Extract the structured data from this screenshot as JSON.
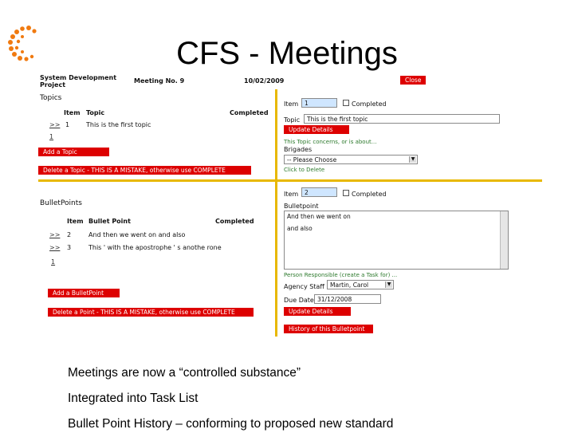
{
  "slide": {
    "title": "CFS - Meetings",
    "bullets": [
      "Meetings are now a “controlled substance”",
      "Integrated into Task List",
      "Bullet Point History – conforming to proposed new standard"
    ]
  },
  "screen": {
    "project_line1": "System Development",
    "project_line2": "Project",
    "meeting_no": "Meeting No. 9",
    "date": "10/02/2009",
    "close_label": "Close",
    "topics": {
      "heading": "Topics",
      "col_item": "Item",
      "col_topic": "Topic",
      "col_completed": "Completed",
      "rows": [
        {
          "marker": ">>",
          "item": "1",
          "text": "This is the first topic"
        }
      ],
      "new_item": "1",
      "add_label": "Add a Topic",
      "delete_label": "Delete a Topic - THIS IS A MISTAKE, otherwise use COMPLETE"
    },
    "topic_detail": {
      "item_label": "Item",
      "item_value": "1",
      "completed_label": "Completed",
      "topic_label": "Topic",
      "topic_value": "This is the first topic",
      "update_label": "Update Details",
      "concerns_text": "This Topic concerns, or is about...",
      "brigades_label": "Brigades",
      "brigades_value": "-- Please Choose",
      "click_delete": "Click to Delete"
    },
    "bullets": {
      "heading": "BulletPoints",
      "col_item": "Item",
      "col_bullet": "Bullet Point",
      "col_completed": "Completed",
      "rows": [
        {
          "marker": ">>",
          "item": "2",
          "text": "And then we went on and also"
        },
        {
          "marker": ">>",
          "item": "3",
          "text": "This ' with the apostrophe ' s anothe rone"
        }
      ],
      "new_item": "1",
      "add_label": "Add a BulletPoint",
      "delete_label": "Delete a Point - THIS IS A MISTAKE, otherwise use COMPLETE"
    },
    "bullet_detail": {
      "item_label": "Item",
      "item_value": "2",
      "completed_label": "Completed",
      "bulletpoint_label": "Bulletpoint",
      "bulletpoint_line1": "And then we went on",
      "bulletpoint_line2": "and also",
      "person_text": "Person Responsible (create a Task for) ...",
      "agency_label": "Agency Staff",
      "agency_value": "Martin, Carol",
      "due_label": "Due Date",
      "due_value": "31/12/2008",
      "update_label": "Update Details",
      "history_label": "History of this Bulletpoint"
    },
    "colors": {
      "accent_red": "#dd0000",
      "divider_yellow": "#e8b800",
      "logo_orange": "#f07a10"
    }
  }
}
